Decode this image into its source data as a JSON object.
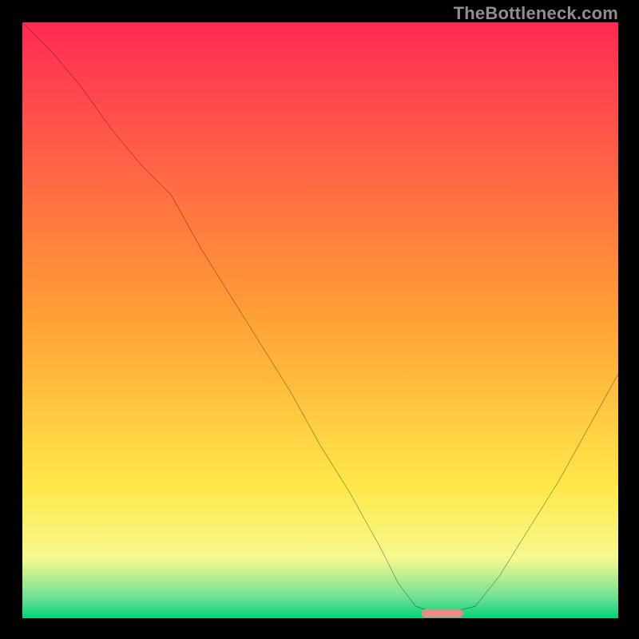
{
  "watermark": "TheBottleneck.com",
  "chart_data": {
    "type": "line",
    "title": "",
    "xlabel": "",
    "ylabel": "",
    "xlim": [
      0,
      100
    ],
    "ylim": [
      0,
      100
    ],
    "grid": false,
    "legend": false,
    "background_gradient": {
      "stops": [
        {
          "pos": 0.0,
          "color": "#ff2a55"
        },
        {
          "pos": 0.5,
          "color": "#ffa135"
        },
        {
          "pos": 0.78,
          "color": "#ffe84a"
        },
        {
          "pos": 0.9,
          "color": "#f6f98f"
        },
        {
          "pos": 0.965,
          "color": "#6fe194"
        },
        {
          "pos": 1.0,
          "color": "#00d37a"
        }
      ]
    },
    "series": [
      {
        "name": "bottleneck-curve",
        "color": "#000000",
        "x": [
          0,
          5,
          10,
          15,
          20,
          25,
          30,
          35,
          40,
          45,
          50,
          55,
          60,
          63,
          66,
          69,
          72,
          76,
          80,
          85,
          90,
          95,
          100
        ],
        "y": [
          100,
          95,
          89,
          82,
          76,
          71,
          62,
          54,
          46,
          38,
          29,
          21,
          12,
          6,
          2,
          1,
          1,
          2,
          7,
          15,
          23,
          32,
          41
        ]
      }
    ],
    "marker": {
      "name": "optimal-band",
      "x_start": 67,
      "x_end": 74,
      "y": 0.8,
      "color": "#e98b87"
    }
  }
}
